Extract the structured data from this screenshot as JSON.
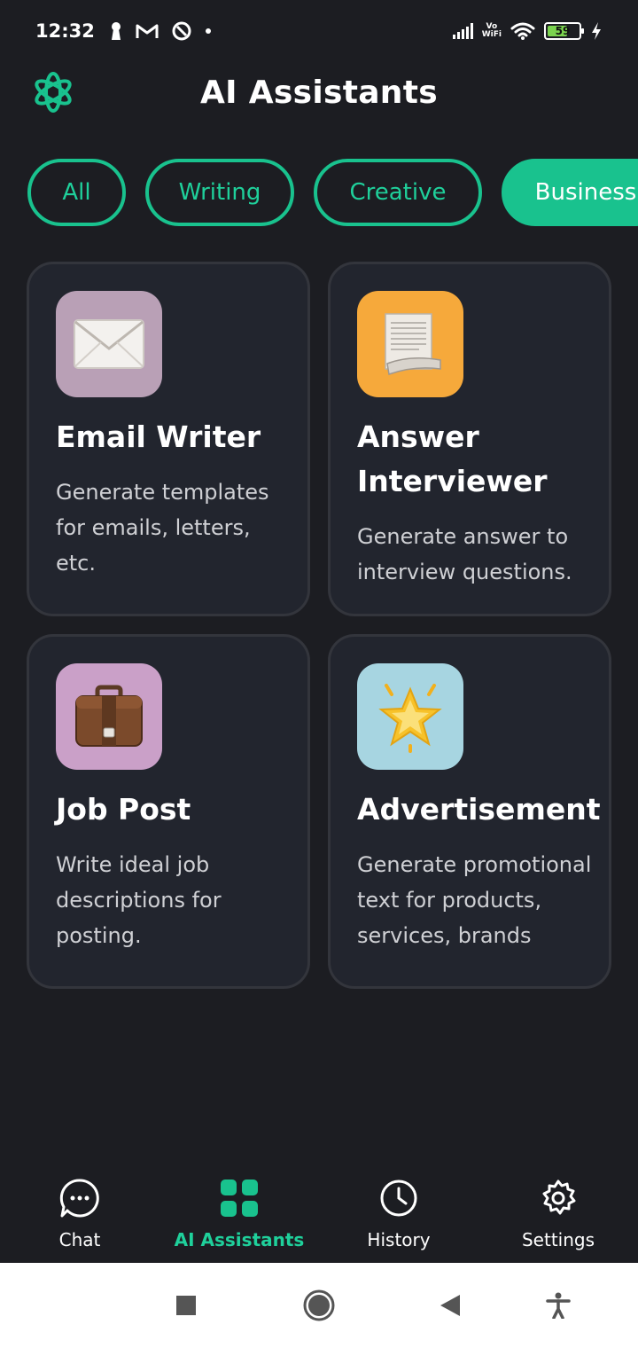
{
  "status_bar": {
    "time": "12:32",
    "battery_level": "59",
    "vowifi_top": "Vo",
    "vowifi_bottom": "WiFi"
  },
  "header": {
    "title": "AI Assistants",
    "logo_icon": "openai-logo-icon"
  },
  "filters": {
    "selected": "Business",
    "items": [
      {
        "label": "All"
      },
      {
        "label": "Writing"
      },
      {
        "label": "Creative"
      },
      {
        "label": "Business"
      }
    ]
  },
  "cards": [
    {
      "title": "Email Writer",
      "description": "Generate templates for emails, letters, etc.",
      "icon": "envelope-icon",
      "icon_bg": "#b9a0b6"
    },
    {
      "title": "Answer Interviewer",
      "description": "Generate answer to interview questions.",
      "icon": "document-scroll-icon",
      "icon_bg": "#f6a93b"
    },
    {
      "title": "Job Post",
      "description": "Write ideal job descriptions for posting.",
      "icon": "briefcase-icon",
      "icon_bg": "#caa0c8"
    },
    {
      "title": "Advertisement",
      "description": "Generate promotional text for products, services, brands",
      "icon": "glowing-star-icon",
      "icon_bg": "#a7d5e1"
    }
  ],
  "bottom_nav": {
    "active": "AI Assistants",
    "items": [
      {
        "label": "Chat",
        "icon": "chat-bubble-icon"
      },
      {
        "label": "AI Assistants",
        "icon": "grid-icon"
      },
      {
        "label": "History",
        "icon": "clock-icon"
      },
      {
        "label": "Settings",
        "icon": "gear-icon"
      }
    ]
  },
  "colors": {
    "accent": "#19c28e",
    "background": "#1c1d22",
    "card_background": "#22252e"
  }
}
